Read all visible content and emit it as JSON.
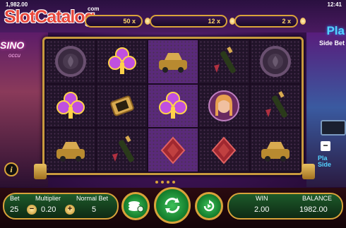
{
  "top": {
    "credit": "1,982.00",
    "clock": "12:41",
    "logo_text": "SlotCatalog",
    "logo_com": "com",
    "multipliers": [
      "50 x",
      "12 x",
      "2 x"
    ]
  },
  "side": {
    "left_logo": "SINO",
    "left_sub": "occu",
    "right_title": "Pla",
    "right_sidebet": "Side Bet",
    "right_play": "Pla\nSide",
    "info": "i",
    "minus": "−"
  },
  "reels": [
    [
      "chip",
      "club",
      "car",
      "champagne",
      "chip"
    ],
    [
      "club",
      "watch",
      "club",
      "lady",
      "champagne"
    ],
    [
      "car",
      "champagne",
      "diamond",
      "diamond",
      "car"
    ]
  ],
  "bottom": {
    "bet_label": "Bet",
    "bet_value": "25",
    "multiplier_label": "Multiplier",
    "multiplier_value": "0.20",
    "normal_bet_label": "Normal Bet",
    "normal_bet_value": "5",
    "win_label": "WIN",
    "win_value": "2.00",
    "balance_label": "BALANCE",
    "balance_value": "1982.00",
    "minus_symbol": "−",
    "plus_symbol": "+"
  },
  "colors": {
    "frame_gold": "#c89a3e",
    "panel_green": "#1d5a2a",
    "accent_blue": "#53d2ff"
  }
}
